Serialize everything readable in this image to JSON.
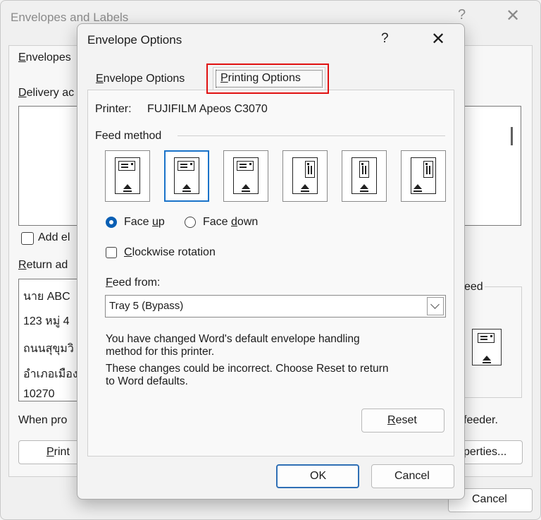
{
  "back_dialog": {
    "title": "Envelopes and Labels",
    "help": "?",
    "close": "✕",
    "tab_envelopes": "Envelopes",
    "delivery_label": "Delivery ac",
    "add_label": "Add el",
    "return_label": "Return ad",
    "return_lines": [
      "นาย ABC",
      "123 หมู่ 4",
      "ถนนสุขุมวิ",
      "อำเภอเมือง",
      "10270"
    ],
    "feed_label": "eed",
    "when_text": "When pro",
    "feeder_text": "feeder.",
    "print_label": "Print",
    "properties_label": "perties...",
    "cancel_label": "Cancel"
  },
  "front_dialog": {
    "title": "Envelope Options",
    "help": "?",
    "close": "✕",
    "tabs": [
      {
        "label": "Envelope Options",
        "selected": false
      },
      {
        "label": "Printing Options",
        "selected": true
      }
    ],
    "printer_label": "Printer:",
    "printer_value": "FUJIFILM Apeos C3070",
    "feed_method_label": "Feed method",
    "feed_options": [
      {
        "icon": "feed-horizontal-left-icon",
        "selected": false
      },
      {
        "icon": "feed-horizontal-center-icon",
        "selected": true
      },
      {
        "icon": "feed-horizontal-right-icon",
        "selected": false
      },
      {
        "icon": "feed-vertical-left-icon",
        "selected": false
      },
      {
        "icon": "feed-vertical-center-icon",
        "selected": false
      },
      {
        "icon": "feed-vertical-right-icon",
        "selected": false
      }
    ],
    "face_up_label": "Face up",
    "face_down_label": "Face down",
    "face_selected": "up",
    "clockwise_label": "Clockwise rotation",
    "clockwise_checked": false,
    "feed_from_label": "Feed from:",
    "feed_from_value": "Tray 5 (Bypass)",
    "message_lines": [
      "You have changed Word's default envelope handling",
      "method for this printer.",
      "These changes could be incorrect. Choose Reset to return",
      "to Word defaults."
    ],
    "reset_label": "Reset",
    "ok_label": "OK",
    "cancel_label": "Cancel"
  },
  "colors": {
    "highlight": "#e01010",
    "accent": "#1a73c9",
    "radio_selected": "#0a5fb4"
  }
}
